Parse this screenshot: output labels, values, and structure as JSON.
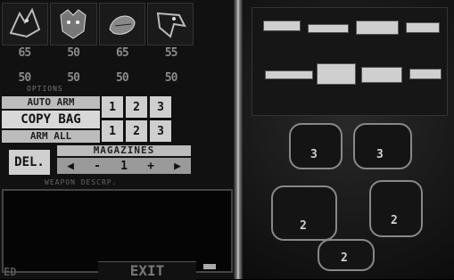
{
  "portraits": [
    {
      "name": "dragon-portrait-icon"
    },
    {
      "name": "panther-portrait-icon"
    },
    {
      "name": "lizard-portrait-icon"
    },
    {
      "name": "eagle-portrait-icon"
    }
  ],
  "stats_row1": [
    "65",
    "50",
    "65",
    "55"
  ],
  "stats_row2": [
    "50",
    "50",
    "50",
    "50"
  ],
  "options_label": "OPTIONS",
  "buttons": {
    "auto_arm": "AUTO ARM",
    "copy_bag": "COPY BAG",
    "arm_all": "ARM ALL",
    "del": "DEL."
  },
  "slots_row1": [
    "1",
    "2",
    "3"
  ],
  "slots_row2": [
    "1",
    "2",
    "3"
  ],
  "magazines": {
    "title": "MAGAZINES",
    "minus": "-",
    "value": "1",
    "plus": "+"
  },
  "weapon_desc_label": "WEAPON DESCRP.",
  "exit_label": "EXIT",
  "bottom_text": "ED",
  "mech_counts": [
    "3",
    "3",
    "2",
    "2",
    "2"
  ],
  "colors": {
    "panel": "#111111",
    "button": "#d0d0d0",
    "text": "#8a8a8a"
  }
}
